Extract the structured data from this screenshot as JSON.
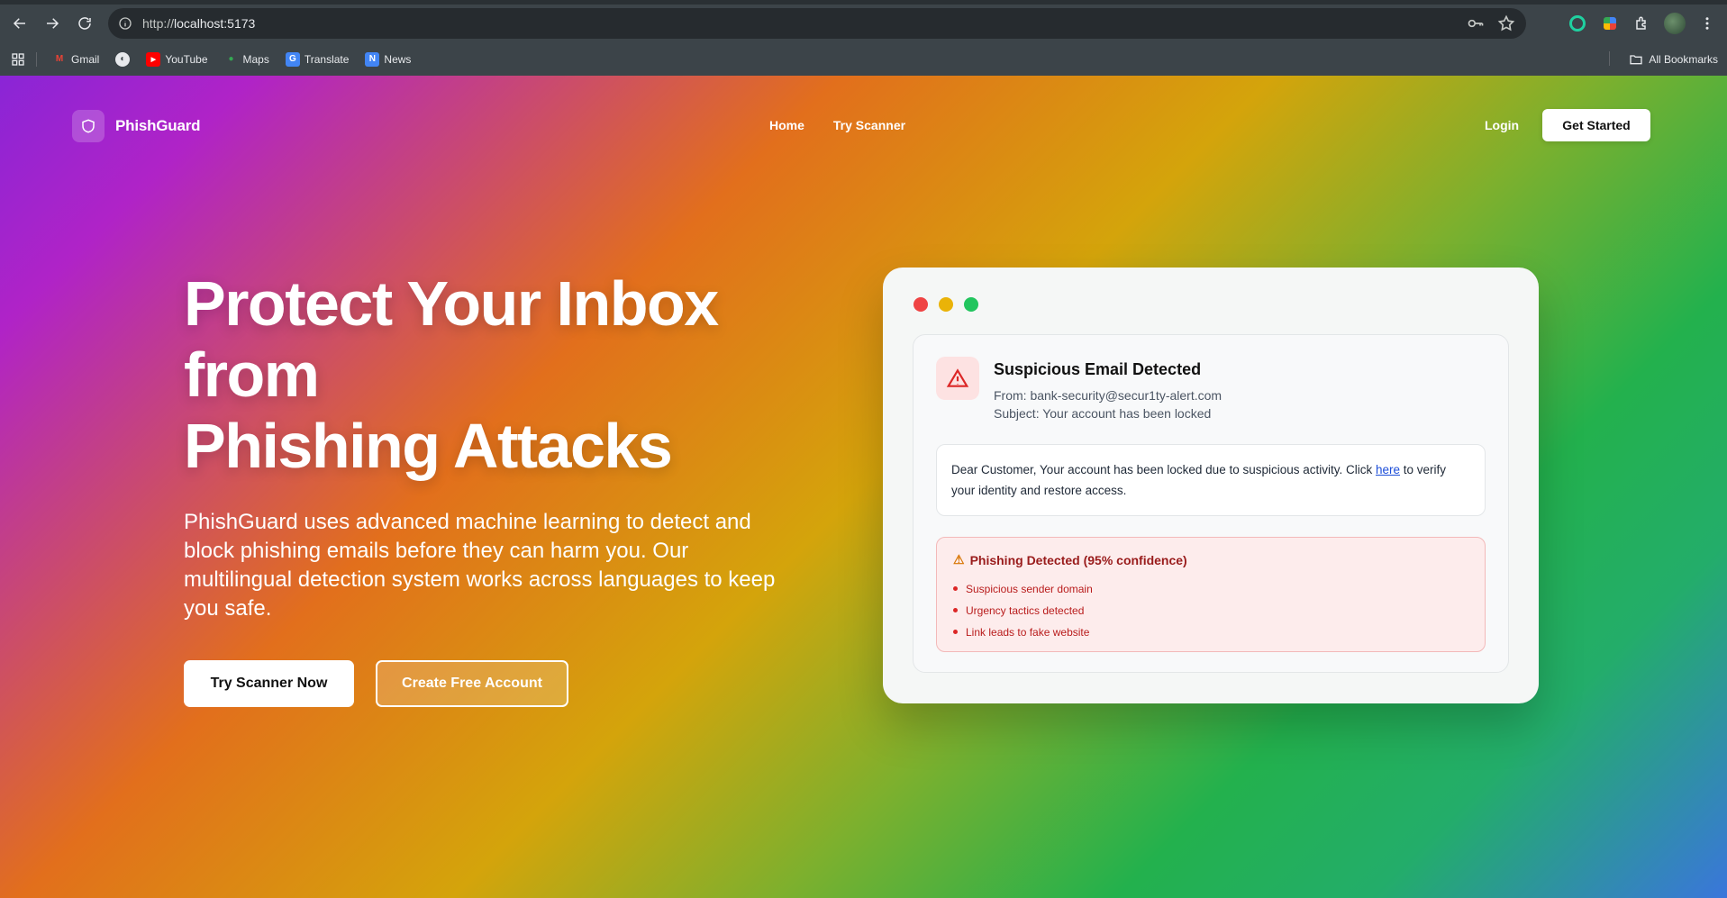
{
  "browser": {
    "url_scheme": "http://",
    "url_host": "localhost:5173",
    "bookmarks": [
      {
        "label": "Gmail",
        "icon": "gmail-icon"
      },
      {
        "label": "",
        "icon": "globe-icon"
      },
      {
        "label": "YouTube",
        "icon": "youtube-icon"
      },
      {
        "label": "Maps",
        "icon": "maps-icon"
      },
      {
        "label": "Translate",
        "icon": "translate-icon"
      },
      {
        "label": "News",
        "icon": "news-icon"
      }
    ],
    "all_bookmarks": "All Bookmarks"
  },
  "nav": {
    "brand": "PhishGuard",
    "links": [
      "Home",
      "Try Scanner"
    ],
    "login": "Login",
    "cta": "Get Started"
  },
  "hero": {
    "title_lines": [
      "Protect Your Inbox",
      "from",
      "Phishing Attacks"
    ],
    "subtitle": "PhishGuard uses advanced machine learning to detect and block phishing emails before they can harm you. Our multilingual detection system works across languages to keep you safe.",
    "primary_button": "Try Scanner Now",
    "secondary_button": "Create Free Account"
  },
  "demo": {
    "window_dots": [
      "#ef4444",
      "#eab308",
      "#22c55e"
    ],
    "email_title": "Suspicious Email Detected",
    "from": "From: bank-security@secur1ty-alert.com",
    "subject": "Subject: Your account has been locked",
    "body_before": "Dear Customer, Your account has been locked due to suspicious activity. Click ",
    "body_link": "here",
    "body_after": " to verify your identity and restore access.",
    "alert_title": "Phishing Detected (95% confidence)",
    "alert_items": [
      "Suspicious sender domain",
      "Urgency tactics detected",
      "Link leads to fake website"
    ]
  },
  "colors": {
    "accent_warning": "#dc2626",
    "alert_text": "#991b1b"
  }
}
